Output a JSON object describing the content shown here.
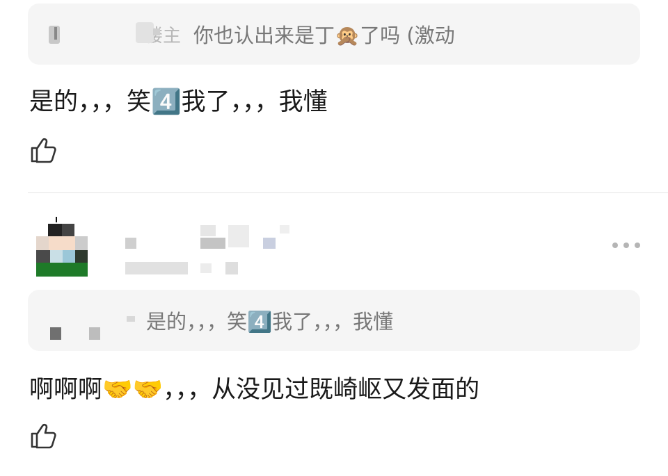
{
  "comment1": {
    "quote_badge": "楼主",
    "quote_text": "你也认出来是丁🙊了吗 (激动",
    "reply_text": "是的，，，笑4️⃣我了，，，我懂"
  },
  "comment2": {
    "quote_text": "是的，，，笑4️⃣我了，，，我懂",
    "reply_text": "啊啊啊🤝🤝，，，从没见过既崎岖又发面的"
  },
  "icons": [
    "thumbs-up-icon",
    "more-dots-icon"
  ],
  "colors": {
    "quote_bg": "#f5f5f5",
    "quote_text": "#777777",
    "body_text": "#1a1a1a",
    "divider": "#e4e4e4",
    "dots": "#b5b5b5"
  }
}
